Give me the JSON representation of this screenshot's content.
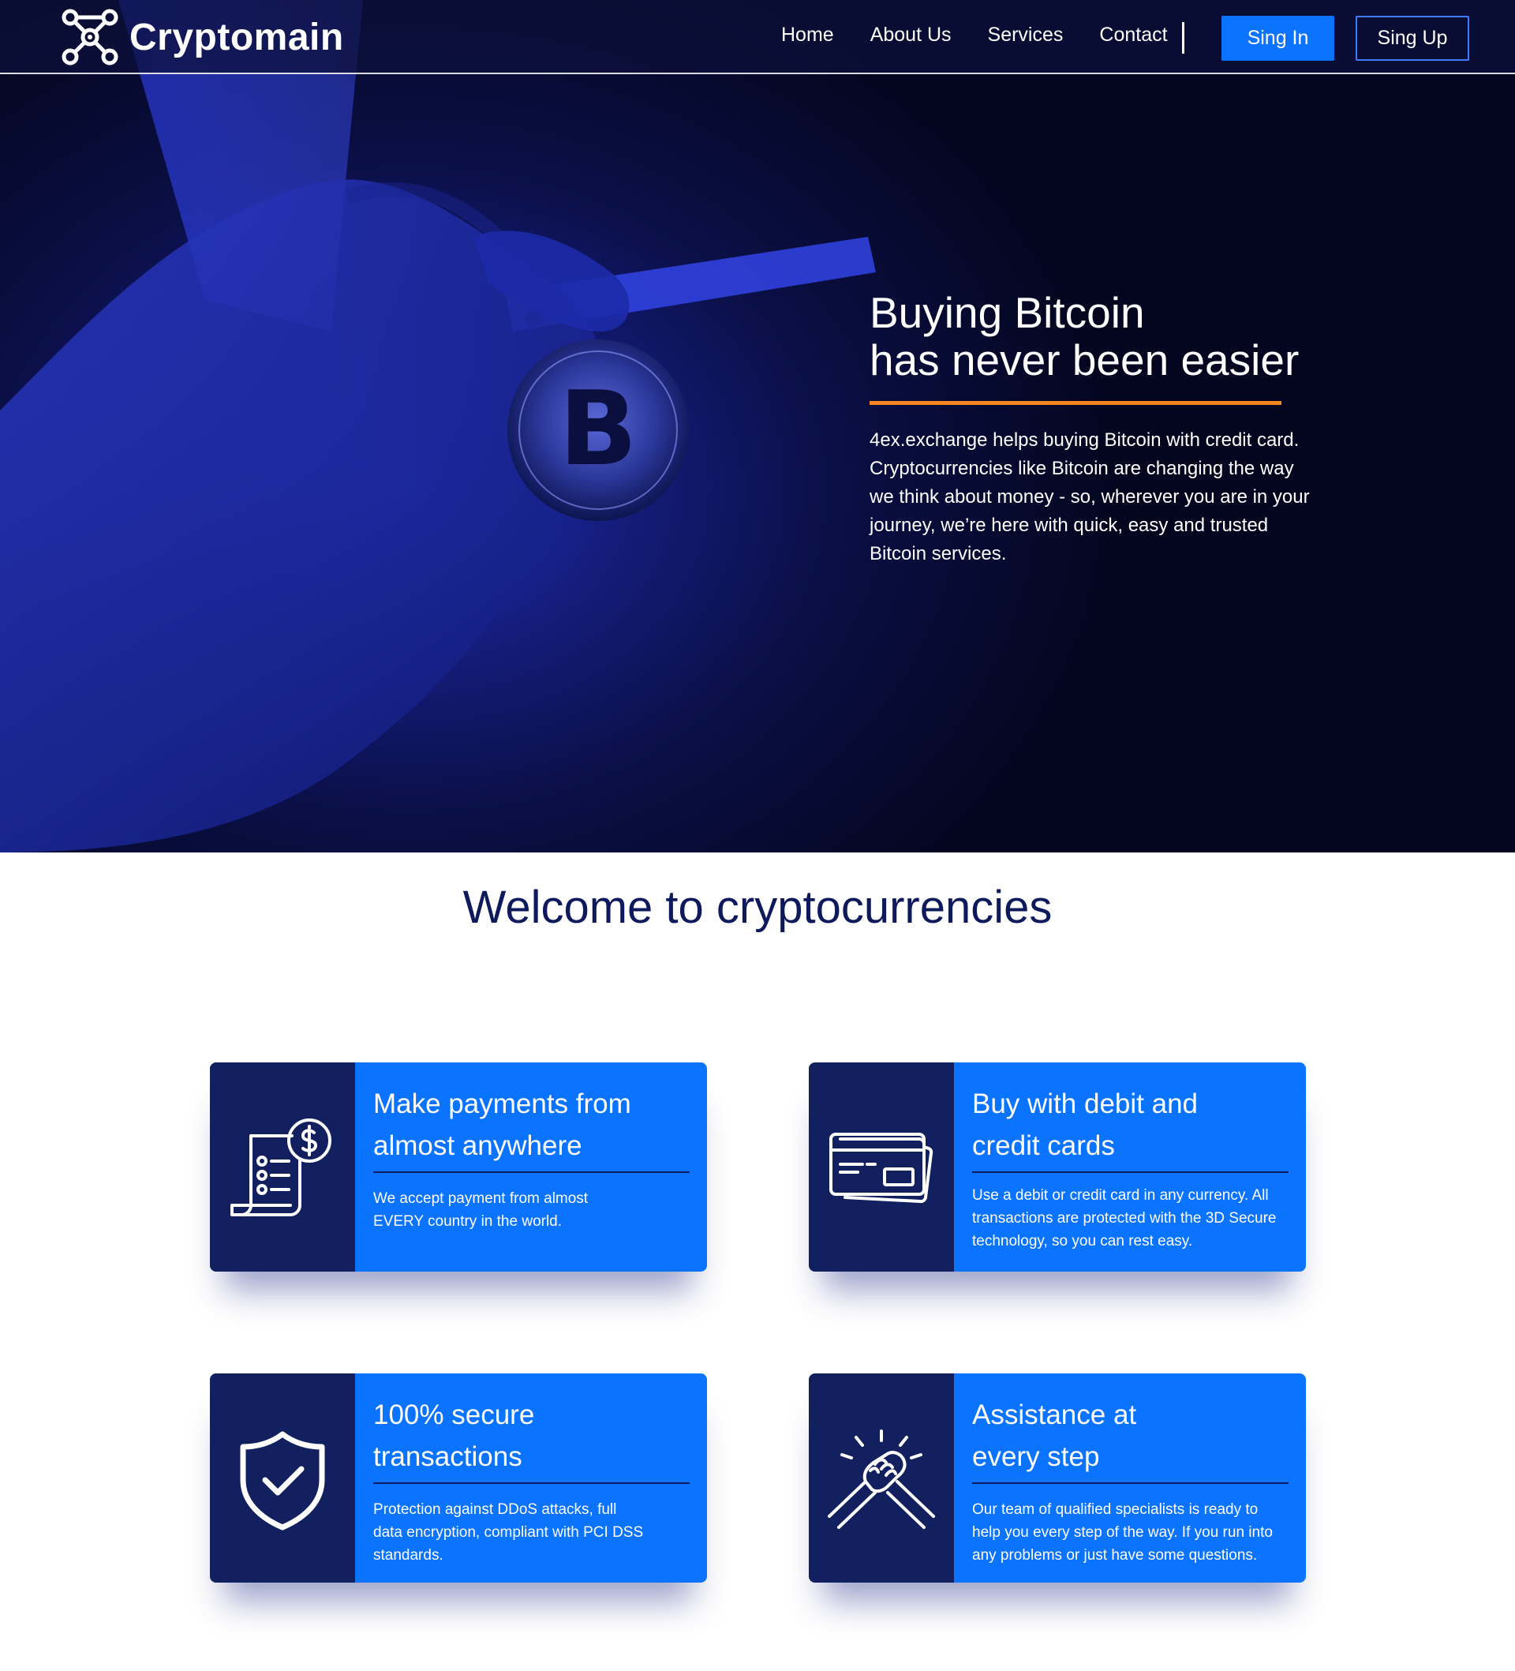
{
  "colors": {
    "accent_blue": "#0a73ff",
    "navy": "#13205f",
    "title_navy": "#0e1a5c",
    "underline_orange": "#f5861f",
    "hero_dark": "#04061f"
  },
  "header": {
    "brand": "Cryptomain",
    "logo_icon": "network-nodes-icon",
    "nav": [
      {
        "label": "Home"
      },
      {
        "label": "About Us"
      },
      {
        "label": "Services"
      },
      {
        "label": "Contact"
      }
    ],
    "signin_label": "Sing In",
    "signup_label": "Sing Up"
  },
  "hero": {
    "title_line1": "Buying Bitcoin",
    "title_line2": "has never been easier",
    "body": "4ex.exchange helps buying Bitcoin with credit card. Cryptocurrencies like Bitcoin are changing the way we think about money - so, wherever you are in your journey, we’re here with quick, easy and trusted Bitcoin services."
  },
  "welcome": {
    "title": "Welcome to cryptocurrencies"
  },
  "features": [
    {
      "icon": "invoice-dollar-icon",
      "title_line1": "Make payments from",
      "title_line2": "almost anywhere",
      "desc": "We accept payment from almost EVERY country in the world."
    },
    {
      "icon": "credit-card-icon",
      "title_line1": "Buy with debit and",
      "title_line2": "credit cards",
      "desc": "Use a debit or credit card in any currency. All transactions are protected with the 3D Secure technology, so you can rest easy."
    },
    {
      "icon": "shield-check-icon",
      "title_line1": "100% secure",
      "title_line2": "transactions",
      "desc": "Protection against DDoS attacks, full data encryption, compliant with PCI DSS standards."
    },
    {
      "icon": "handshake-icon",
      "title_line1": "Assistance at",
      "title_line2": "every step",
      "desc": "Our team of qualified specialists is ready to help you every step of the way. If you run into any problems or just have some questions."
    }
  ]
}
